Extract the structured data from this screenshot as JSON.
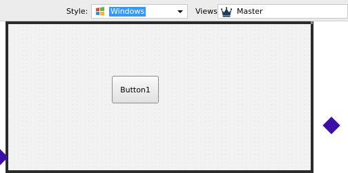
{
  "toolbar": {
    "style_label": "Style:",
    "style_value": "Windows",
    "style_icon": "windows-flag-icon",
    "views_label": "Views:",
    "views_value": "Master",
    "views_icon": "crown-icon"
  },
  "form": {
    "button_label": "Button1"
  },
  "colors": {
    "selection": "#3399ff",
    "handle": "#3b0fa8",
    "frame_border": "#2b2b2b"
  }
}
